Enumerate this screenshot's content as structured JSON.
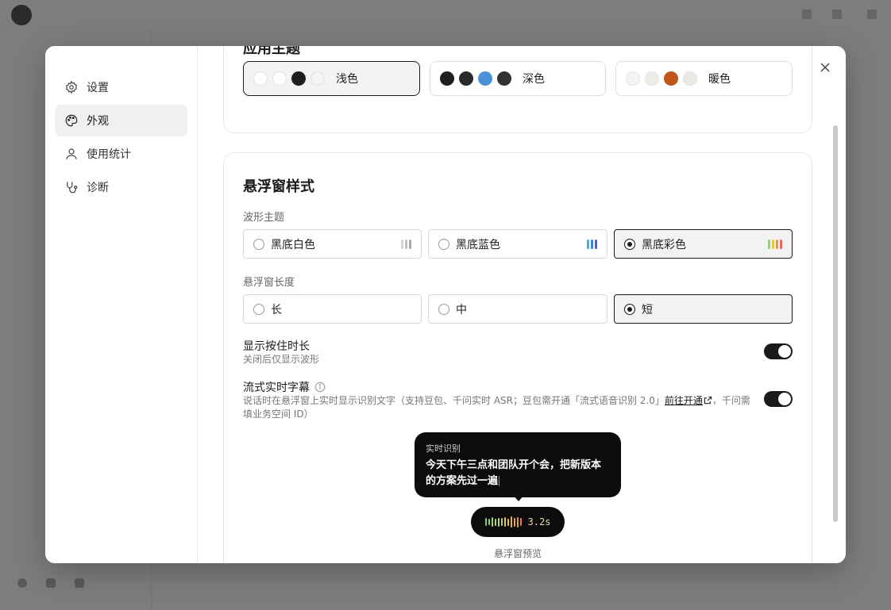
{
  "nav": {
    "items": [
      {
        "label": "设置",
        "icon": "gear-icon"
      },
      {
        "label": "外观",
        "icon": "palette-icon",
        "active": true
      },
      {
        "label": "使用统计",
        "icon": "user-icon"
      },
      {
        "label": "诊断",
        "icon": "stethoscope-icon"
      }
    ]
  },
  "app_theme": {
    "title": "应用主题",
    "options": [
      {
        "label": "浅色",
        "selected": true,
        "swatches": [
          "#ffffff",
          "#ffffff",
          "#1f1f1f",
          "#f5f5f5"
        ]
      },
      {
        "label": "深色",
        "selected": false,
        "swatches": [
          "#1f1f1f",
          "#2a2a2a",
          "#4a90d9",
          "#333333"
        ]
      },
      {
        "label": "暖色",
        "selected": false,
        "swatches": [
          "#f6f4f0",
          "#ecebe7",
          "#c2561a",
          "#ebe9e4"
        ]
      }
    ]
  },
  "float_window": {
    "title": "悬浮窗样式",
    "wave_theme": {
      "label": "波形主题",
      "options": [
        {
          "label": "黑底白色",
          "selected": false
        },
        {
          "label": "黑底蓝色",
          "selected": false
        },
        {
          "label": "黑底彩色",
          "selected": true
        }
      ]
    },
    "length": {
      "label": "悬浮窗长度",
      "options": [
        {
          "label": "长",
          "selected": false
        },
        {
          "label": "中",
          "selected": false
        },
        {
          "label": "短",
          "selected": true
        }
      ]
    },
    "show_hold_duration": {
      "title": "显示按住时长",
      "desc": "关闭后仅显示波形",
      "enabled": true
    },
    "streaming_subtitles": {
      "title": "流式实时字幕",
      "desc_before": "说话时在悬浮窗上实时显示识别文字（支持豆包、千问实时 ASR；豆包需开通「流式语音识别 2.0」",
      "link": "前往开通",
      "desc_after": "，千问需填业务空间 ID）",
      "enabled": true
    },
    "preview": {
      "bubble_label": "实时识别",
      "bubble_text": "今天下午三点和团队开个会，把新版本的方案先过一遍",
      "time": "3.2s",
      "caption": "悬浮窗预览"
    }
  },
  "colors": {
    "accent": "#1a1a1a",
    "wave_white": [
      "#d0d0d0",
      "#b8b8b8",
      "#a0a0a0"
    ],
    "wave_blue": [
      "#3ab4e6",
      "#3a82e6",
      "#4a5ee6"
    ],
    "wave_color": [
      "#8fd36a",
      "#e6c443",
      "#e69a3a",
      "#e66a5a"
    ]
  }
}
